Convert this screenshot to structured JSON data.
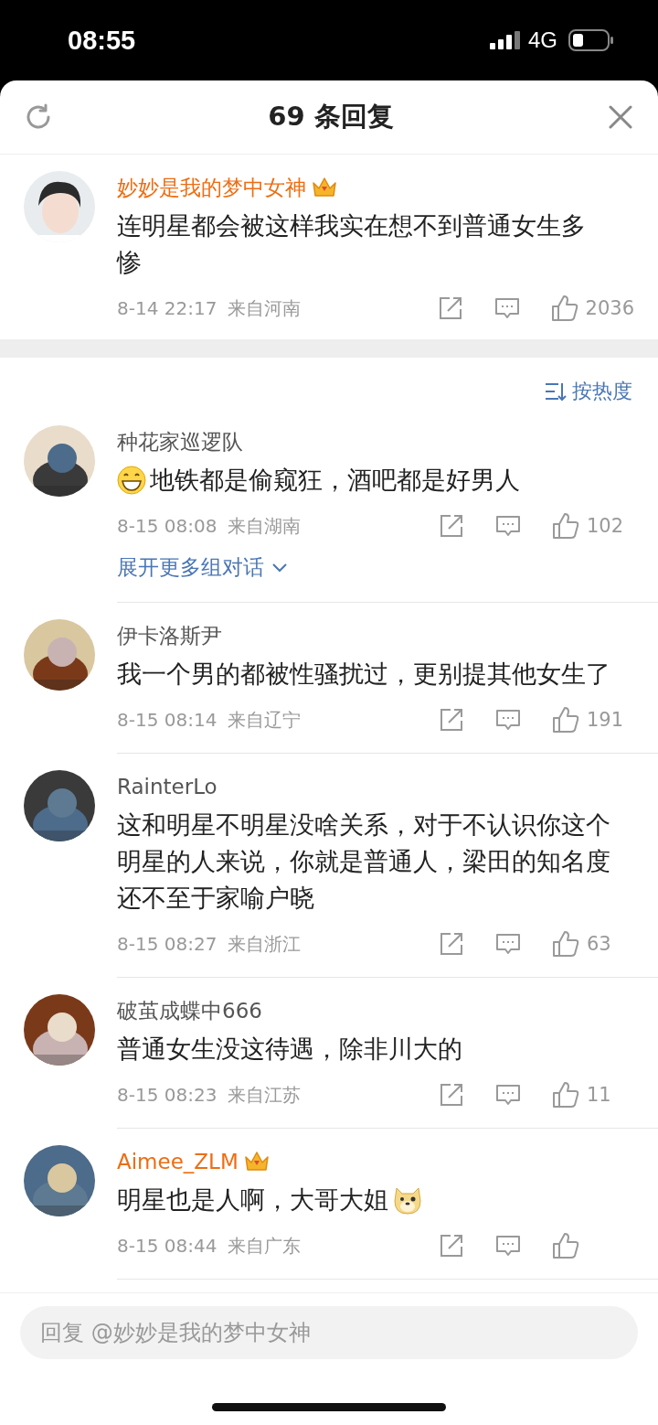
{
  "status_bar": {
    "time": "08:55",
    "network": "4G"
  },
  "header": {
    "title": "69 条回复"
  },
  "root_comment": {
    "name": "妙妙是我的梦中女神",
    "vip": true,
    "text": "连明星都会被这样我实在想不到普通女生多惨",
    "time": "8-14 22:17",
    "location": "来自河南",
    "likes": "2036"
  },
  "sort": {
    "label": "按热度"
  },
  "replies": [
    {
      "name": "种花家巡逻队",
      "vip": false,
      "kind": "emoji_lead",
      "text": "地铁都是偷窥狂，酒吧都是好男人",
      "time": "8-15 08:08",
      "location": "来自湖南",
      "likes": "102",
      "more": "展开更多组对话"
    },
    {
      "name": "伊卡洛斯尹",
      "vip": false,
      "kind": "plain",
      "text": "我一个男的都被性骚扰过，更别提其他女生了",
      "time": "8-15 08:14",
      "location": "来自辽宁",
      "likes": "191"
    },
    {
      "name": "RainterLo",
      "vip": false,
      "kind": "plain",
      "text": "这和明星不明星没啥关系，对于不认识你这个明星的人来说，你就是普通人，梁田的知名度还不至于家喻户晓",
      "time": "8-15 08:27",
      "location": "来自浙江",
      "likes": "63"
    },
    {
      "name": "破茧成蝶中666",
      "vip": false,
      "kind": "plain",
      "text": "普通女生没这待遇，除非川大的",
      "time": "8-15 08:23",
      "location": "来自江苏",
      "likes": "11"
    },
    {
      "name": "Aimee_ZLM",
      "vip": true,
      "kind": "emoji_trail",
      "text": "明星也是人啊，大哥大姐",
      "time": "8-15 08:44",
      "location": "来自广东"
    }
  ],
  "reply_box": {
    "placeholder": "回复 @妙妙是我的梦中女神"
  }
}
